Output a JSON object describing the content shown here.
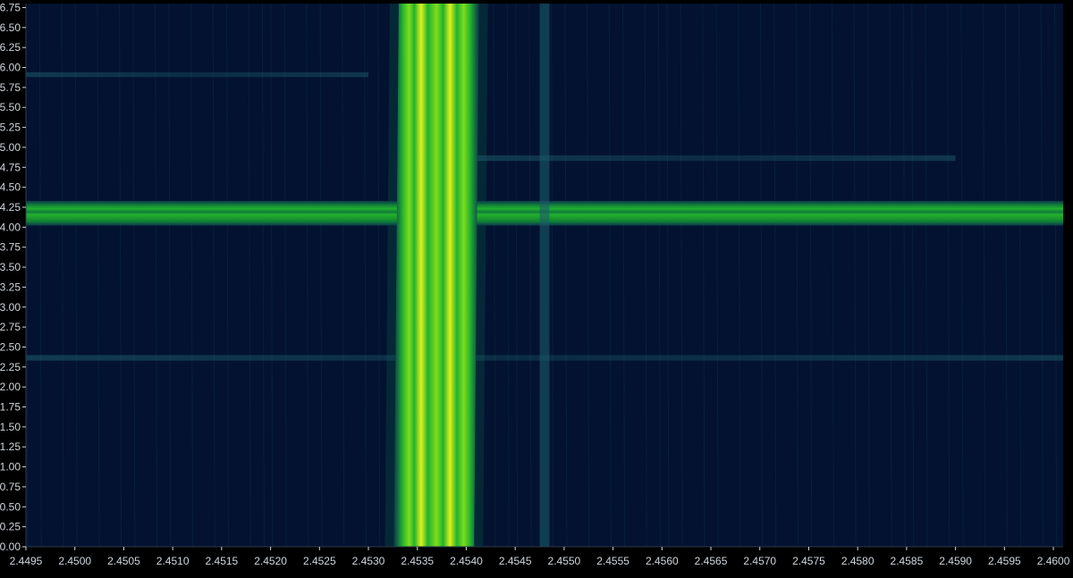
{
  "chart_data": {
    "type": "heatmap",
    "title": "",
    "xlabel": "",
    "ylabel": "",
    "colormap": [
      "#03102a",
      "#0d3a4e",
      "#0f7a3a",
      "#22b12f",
      "#7fdd1c",
      "#dff21a"
    ],
    "background_color": "#021230",
    "axis_color": "#cfd6de",
    "grid": false,
    "xlim": [
      2.4495,
      2.4601
    ],
    "ylim": [
      0,
      6.8
    ],
    "x_ticks": [
      {
        "value": 2.4495,
        "label": "2.4495"
      },
      {
        "value": 2.45,
        "label": "2.4500"
      },
      {
        "value": 2.4505,
        "label": "2.4505"
      },
      {
        "value": 2.451,
        "label": "2.4510"
      },
      {
        "value": 2.4515,
        "label": "2.4515"
      },
      {
        "value": 2.452,
        "label": "2.4520"
      },
      {
        "value": 2.4525,
        "label": "2.4525"
      },
      {
        "value": 2.453,
        "label": "2.4530"
      },
      {
        "value": 2.4535,
        "label": "2.4535"
      },
      {
        "value": 2.454,
        "label": "2.4540"
      },
      {
        "value": 2.4545,
        "label": "2.4545"
      },
      {
        "value": 2.455,
        "label": "2.4550"
      },
      {
        "value": 2.4555,
        "label": "2.4555"
      },
      {
        "value": 2.456,
        "label": "2.4560"
      },
      {
        "value": 2.4565,
        "label": "2.4565"
      },
      {
        "value": 2.457,
        "label": "2.4570"
      },
      {
        "value": 2.4575,
        "label": "2.4575"
      },
      {
        "value": 2.458,
        "label": "2.4580"
      },
      {
        "value": 2.4585,
        "label": "2.4585"
      },
      {
        "value": 2.459,
        "label": "2.4590"
      },
      {
        "value": 2.4595,
        "label": "2.4595"
      },
      {
        "value": 2.46,
        "label": "2.4600"
      }
    ],
    "y_ticks": [
      {
        "value": 0.0,
        "label": "0.00"
      },
      {
        "value": 0.25,
        "label": "0.25"
      },
      {
        "value": 0.5,
        "label": "0.50"
      },
      {
        "value": 0.75,
        "label": "0.75"
      },
      {
        "value": 1.0,
        "label": "1.00"
      },
      {
        "value": 1.25,
        "label": "1.25"
      },
      {
        "value": 1.5,
        "label": "1.50"
      },
      {
        "value": 1.75,
        "label": "1.75"
      },
      {
        "value": 2.0,
        "label": "2.00"
      },
      {
        "value": 2.25,
        "label": "2.25"
      },
      {
        "value": 2.5,
        "label": "2.50"
      },
      {
        "value": 2.75,
        "label": "2.75"
      },
      {
        "value": 3.0,
        "label": "3.00"
      },
      {
        "value": 3.25,
        "label": "3.25"
      },
      {
        "value": 3.5,
        "label": "3.50"
      },
      {
        "value": 3.75,
        "label": "3.75"
      },
      {
        "value": 4.0,
        "label": "4.00"
      },
      {
        "value": 4.25,
        "label": "4.25"
      },
      {
        "value": 4.5,
        "label": "4.50"
      },
      {
        "value": 4.75,
        "label": "4.75"
      },
      {
        "value": 5.0,
        "label": "5.00"
      },
      {
        "value": 5.25,
        "label": "5.25"
      },
      {
        "value": 5.5,
        "label": "5.50"
      },
      {
        "value": 5.75,
        "label": "5.75"
      },
      {
        "value": 6.0,
        "label": "6.00"
      },
      {
        "value": 6.25,
        "label": "6.25"
      },
      {
        "value": 6.5,
        "label": "6.50"
      },
      {
        "value": 6.75,
        "label": "6.75"
      }
    ],
    "signals": [
      {
        "orientation": "vertical",
        "x_start": 2.45326,
        "x_end": 2.45408,
        "y_start": 0,
        "y_end": 6.8,
        "lean": 5e-05,
        "intensity": "high",
        "stripes": 5
      },
      {
        "orientation": "horizontal",
        "y_start": 4.02,
        "y_end": 4.33,
        "x_start": 2.4495,
        "x_end": 2.4601,
        "intensity": "medium"
      },
      {
        "orientation": "vertical",
        "x_start": 2.45475,
        "x_end": 2.45485,
        "y_start": 0,
        "y_end": 6.8,
        "intensity": "low"
      },
      {
        "orientation": "horizontal",
        "y_start": 2.33,
        "y_end": 2.4,
        "x_start": 2.4495,
        "x_end": 2.4601,
        "intensity": "faint"
      },
      {
        "orientation": "horizontal",
        "y_start": 4.83,
        "y_end": 4.9,
        "x_start": 2.454,
        "x_end": 2.459,
        "intensity": "faint"
      },
      {
        "orientation": "horizontal",
        "y_start": 5.88,
        "y_end": 5.94,
        "x_start": 2.4495,
        "x_end": 2.453,
        "intensity": "faint"
      }
    ]
  }
}
